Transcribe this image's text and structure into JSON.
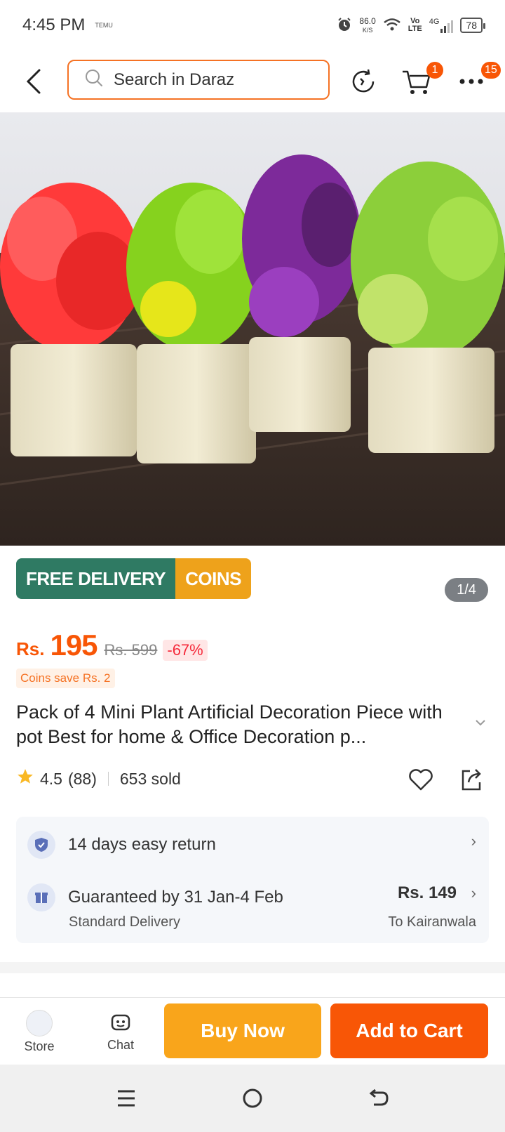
{
  "status_bar": {
    "time": "4:45 PM",
    "notif": "TEMU",
    "speed_value": "86.0",
    "speed_unit": "K/S",
    "lte_top": "Vo",
    "lte_bottom": "LTE",
    "network": "4G",
    "battery": "78"
  },
  "header": {
    "search_placeholder": "Search in Daraz",
    "cart_badge": "1",
    "more_badge": "15"
  },
  "promo": {
    "free_delivery": "FREE DELIVERY",
    "coins": "COINS",
    "page_indicator": "1/4"
  },
  "price": {
    "currency": "Rs.",
    "value": "195",
    "original": "Rs. 599",
    "discount": "-67%",
    "coins_save": "Coins save Rs. 2"
  },
  "product": {
    "title": "Pack of 4 Mini Plant Artificial Decoration Piece with pot Best for home & Office Decoration p...",
    "rating": "4.5",
    "reviews": "(88)",
    "sold": "653 sold"
  },
  "info": {
    "return_text": "14 days easy return",
    "guarantee_text": "Guaranteed by 31 Jan-4 Feb",
    "delivery_type": "Standard Delivery",
    "delivery_price": "Rs. 149",
    "delivery_location": "To Kairanwala"
  },
  "bottom_bar": {
    "store": "Store",
    "chat": "Chat",
    "buy_now": "Buy Now",
    "add_to_cart": "Add to Cart"
  },
  "colors": {
    "accent": "#f85606",
    "buy_now": "#f9a51b",
    "free_delivery": "#2f7a63",
    "coins": "#eea21b"
  }
}
